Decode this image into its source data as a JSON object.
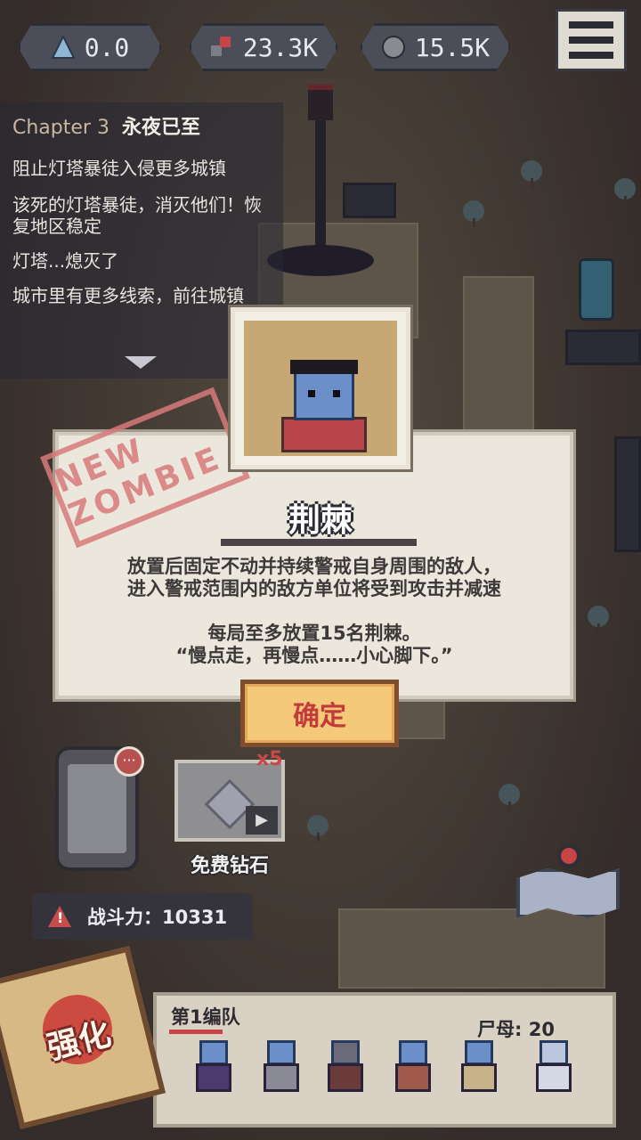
{
  "resources": [
    {
      "icon": "triangle-gem-icon",
      "value": "0.0"
    },
    {
      "icon": "blood-cells-icon",
      "value": "23.3K"
    },
    {
      "icon": "brain-orb-icon",
      "value": "15.5K"
    }
  ],
  "quest_panel": {
    "chapter_number": "Chapter 3",
    "chapter_name": "永夜已至",
    "items": [
      "阻止灯塔暴徒入侵更多城镇",
      "该死的灯塔暴徒，消灭他们！恢复地区稳定",
      "灯塔...熄灭了",
      "城市里有更多线索，前往城镇"
    ]
  },
  "modal": {
    "stamp": "NEW ZOMBIE",
    "title": "荆棘",
    "description_line1": "放置后固定不动并持续警戒自身周围的敌人，",
    "description_line2": "进入警戒范围内的敌方单位将受到攻击并减速",
    "limit": "每局至多放置15名荆棘。",
    "quote": "“慢点走，再慢点……小心脚下。”",
    "confirm_label": "确定"
  },
  "phone_badge": "···",
  "free_diamond": {
    "count": "x5",
    "label": "免费钻石"
  },
  "combat_power": {
    "label": "战斗力：",
    "value": "10331"
  },
  "team": {
    "name": "第1编队",
    "capacity_label": "尸母: 20"
  },
  "enhance_label": "强化",
  "colors": {
    "accent_red": "#c84545",
    "button_gold": "#f4c97a",
    "panel_paper": "#ece7dd"
  }
}
